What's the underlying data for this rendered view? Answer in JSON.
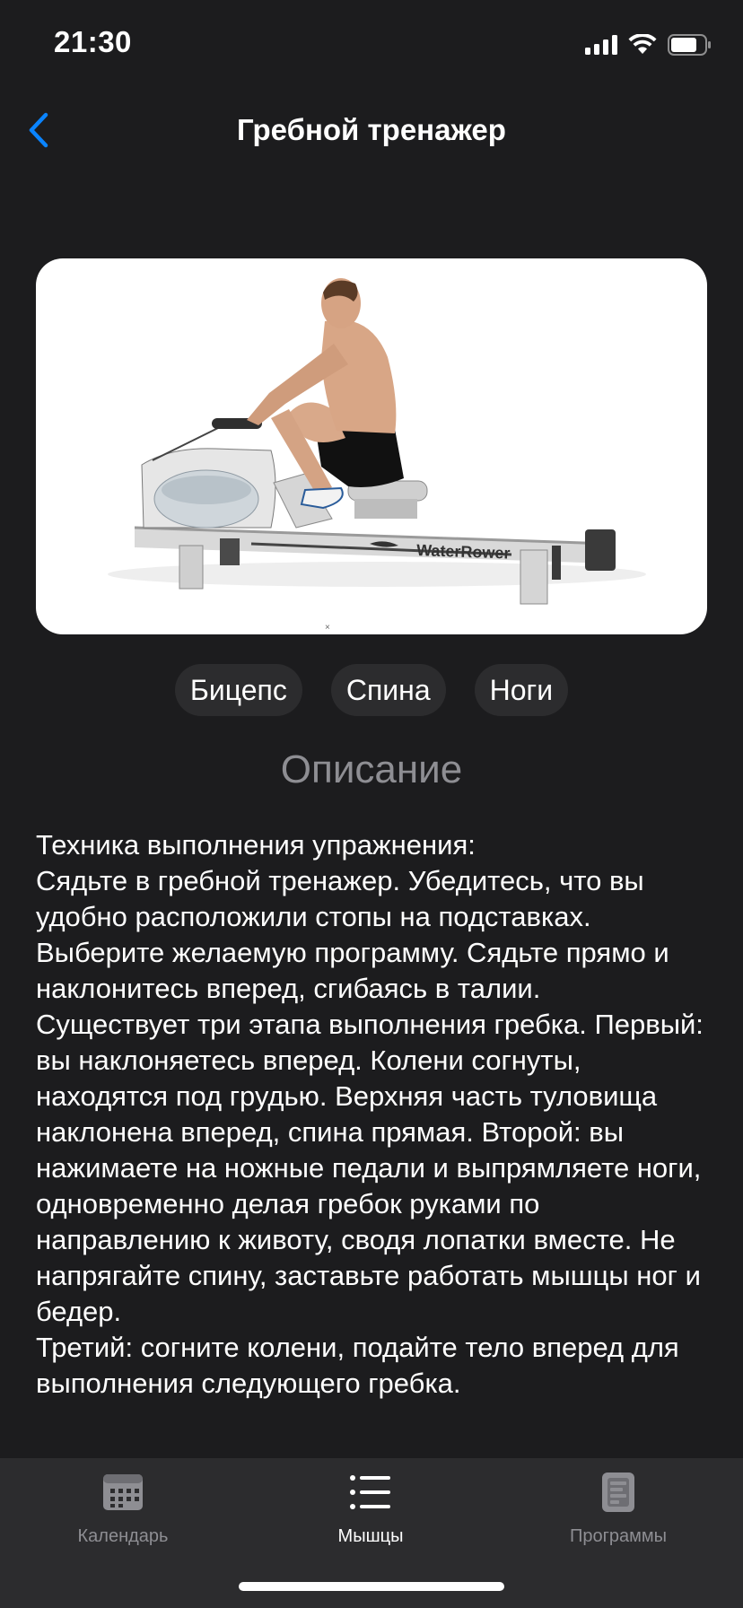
{
  "status_bar": {
    "time": "21:30"
  },
  "nav": {
    "title": "Гребной тренажер",
    "back_icon": "chevron-left-icon"
  },
  "image": {
    "brand_text": "WaterRower"
  },
  "muscles": [
    "Бицепс",
    "Спина",
    "Ноги"
  ],
  "description": {
    "title": "Описание",
    "text": "Техника выполнения упражнения:\nСядьте в гребной тренажер. Убедитесь, что вы удобно расположили стопы на подставках. Выберите желаемую программу. Сядьте прямо и наклонитесь вперед, сгибаясь в талии.\nСуществует три этапа выполнения гребка. Первый: вы наклоняетесь вперед. Колени согнуты, находятся под грудью. Верхняя часть туловища наклонена вперед, спина прямая. Второй: вы нажимаете на ножные педали и выпрямляете ноги, одновременно делая гребок руками по направлению к животу, сводя лопатки вместе. Не напрягайте спину, заставьте работать мышцы ног и бедер.\nТретий: согните колени, подайте тело вперед для выполнения следующего гребка."
  },
  "tabs": [
    {
      "label": "Календарь",
      "icon": "calendar-icon",
      "active": false
    },
    {
      "label": "Мышцы",
      "icon": "list-icon",
      "active": true
    },
    {
      "label": "Программы",
      "icon": "document-icon",
      "active": false
    }
  ],
  "colors": {
    "background": "#1c1c1e",
    "accent": "#0a84ff",
    "chip": "#2c2c2e",
    "muted": "#8e8e93"
  }
}
